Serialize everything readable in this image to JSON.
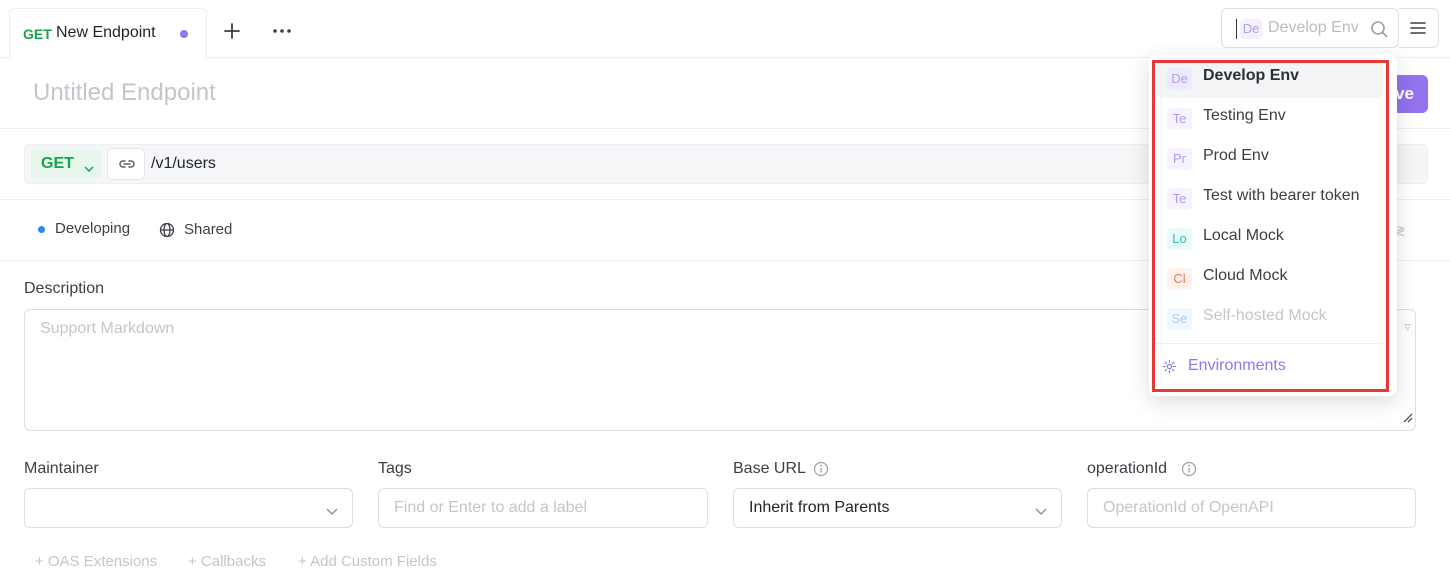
{
  "tab": {
    "method": "GET",
    "name": "New Endpoint"
  },
  "env_select": {
    "badge": "De",
    "value": "Develop Env"
  },
  "page": {
    "title": "Untitled Endpoint",
    "save_label": "ve"
  },
  "request": {
    "method": "GET",
    "path": "/v1/users"
  },
  "status": {
    "state": "Developing",
    "visibility": "Shared"
  },
  "description": {
    "label": "Description",
    "placeholder": "Support Markdown"
  },
  "fields": {
    "maintainer": {
      "label": "Maintainer",
      "value": ""
    },
    "tags": {
      "label": "Tags",
      "placeholder": "Find or Enter to add a label"
    },
    "base_url": {
      "label": "Base URL",
      "value": "Inherit from Parents"
    },
    "operation_id": {
      "label": "operationId",
      "placeholder": "OperationId of OpenAPI"
    }
  },
  "extras": [
    "+ OAS Extensions",
    "+ Callbacks",
    "+ Add Custom Fields"
  ],
  "dropdown": {
    "items": [
      {
        "abbr": "De",
        "label": "Develop Env",
        "color": "#b59cf3",
        "bg": "#efe9fd",
        "state": "active"
      },
      {
        "abbr": "Te",
        "label": "Testing Env",
        "color": "#b59cf3",
        "bg": "#f6f2fe",
        "state": "normal"
      },
      {
        "abbr": "Pr",
        "label": "Prod Env",
        "color": "#b59cf3",
        "bg": "#f6f2fe",
        "state": "normal"
      },
      {
        "abbr": "Te",
        "label": "Test with bearer token",
        "color": "#b59cf3",
        "bg": "#f6f2fe",
        "state": "normal"
      },
      {
        "abbr": "Lo",
        "label": "Local Mock",
        "color": "#2cc3b6",
        "bg": "#eafaf8",
        "state": "normal"
      },
      {
        "abbr": "Cl",
        "label": "Cloud Mock",
        "color": "#f07a4a",
        "bg": "#fff1eb",
        "state": "normal"
      },
      {
        "abbr": "Se",
        "label": "Self-hosted Mock",
        "color": "#a9cdf6",
        "bg": "#f0f7fe",
        "state": "disabled"
      }
    ],
    "footer_label": "Environments"
  },
  "colors": {
    "accent": "#9373ee",
    "get_method": "#17a34a",
    "status_developing": "#2f86f6",
    "highlight": "#e53935"
  }
}
